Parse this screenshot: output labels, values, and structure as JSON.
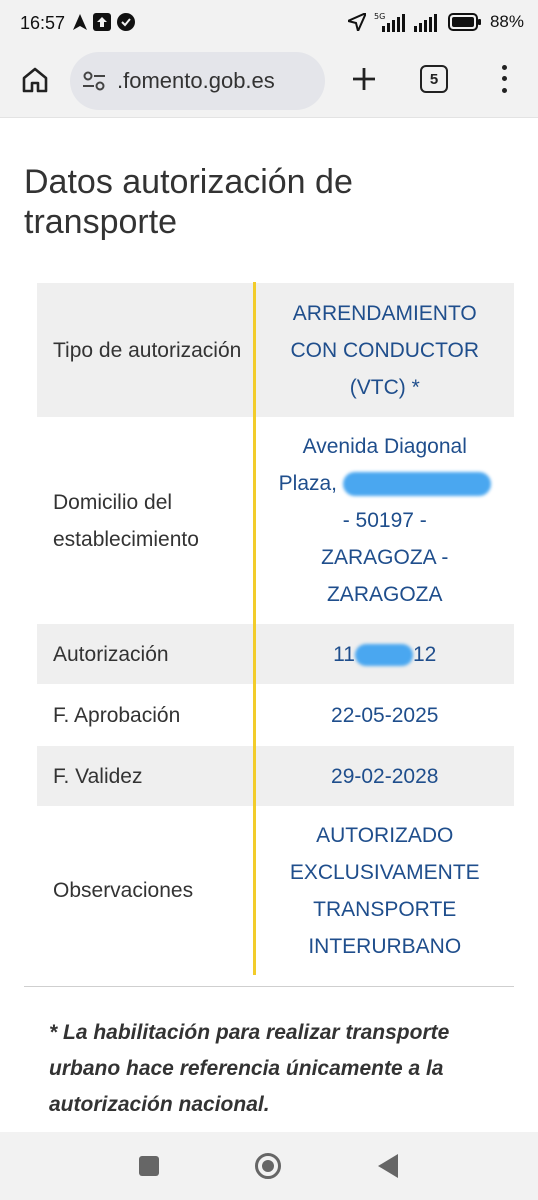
{
  "status_bar": {
    "time": "16:57",
    "network": "5G",
    "battery": "88%"
  },
  "browser": {
    "url": ".fomento.gob.es",
    "tab_count": "5"
  },
  "page": {
    "title": "Datos autorización de transporte"
  },
  "table": {
    "rows": [
      {
        "label": "Tipo de autorización",
        "value_lines": [
          "ARRENDAMIENTO",
          "CON CONDUCTOR",
          "(VTC) *"
        ]
      },
      {
        "label": "Domicilio del establecimiento",
        "value_lines": [
          "Avenida Diagonal",
          "Plaza,",
          "- 50197 -",
          "ZARAGOZA -",
          "ZARAGOZA"
        ]
      },
      {
        "label": "Autorización",
        "value_prefix": "11",
        "value_suffix": "12"
      },
      {
        "label": "F. Aprobación",
        "value": "22-05-2025"
      },
      {
        "label": "F. Validez",
        "value": "29-02-2028"
      },
      {
        "label": "Observaciones",
        "value_lines": [
          "AUTORIZADO",
          "EXCLUSIVAMENTE",
          "TRANSPORTE",
          "INTERURBANO"
        ]
      }
    ]
  },
  "note": "* La habilitación para realizar transporte urbano hace referencia únicamente a la autorización nacional."
}
